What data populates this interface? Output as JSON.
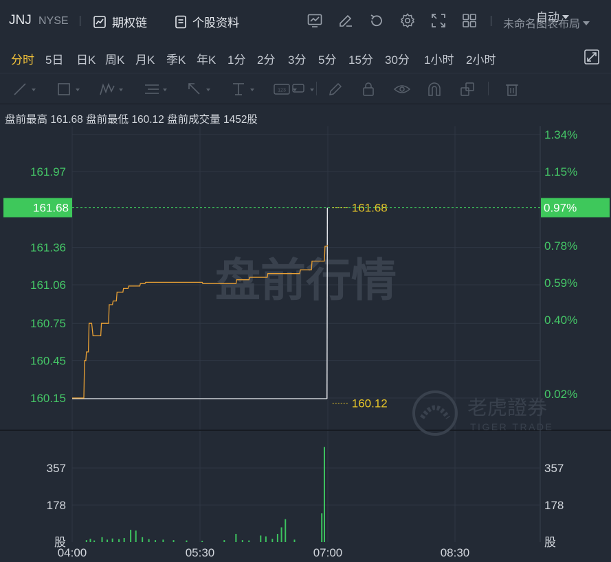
{
  "header": {
    "symbol": "JNJ",
    "exchange": "NYSE",
    "options_chain_label": "期权链",
    "profile_label": "个股资料",
    "layout_name": "未命名图表布局"
  },
  "periods": [
    {
      "label": "分时",
      "active": true
    },
    {
      "label": "5日",
      "active": false
    },
    {
      "label": "日K",
      "active": false
    },
    {
      "label": "周K",
      "active": false
    },
    {
      "label": "月K",
      "active": false
    },
    {
      "label": "季K",
      "active": false
    },
    {
      "label": "年K",
      "active": false
    },
    {
      "label": "1分",
      "active": false
    },
    {
      "label": "2分",
      "active": false
    },
    {
      "label": "3分",
      "active": false
    },
    {
      "label": "5分",
      "active": false
    },
    {
      "label": "15分",
      "active": false
    },
    {
      "label": "30分",
      "active": false
    },
    {
      "label": "1小时",
      "active": false
    },
    {
      "label": "2小时",
      "active": false
    }
  ],
  "auto_label": "自动",
  "drawing_tools": [
    "line-tool-icon",
    "rectangle-tool-icon",
    "pattern-tool-icon",
    "fib-tool-icon",
    "arrow-tool-icon",
    "measure-tool-icon",
    "label-tool-icon",
    "comment-tool-icon",
    "pen-icon",
    "lock-icon",
    "eye-icon",
    "magnet-icon",
    "layers-icon",
    "trash-icon"
  ],
  "info": {
    "high_label": "盘前最高",
    "high_value": "161.68",
    "low_label": "盘前最低",
    "low_value": "160.12",
    "volume_label": "盘前成交量",
    "volume_value": "1452股"
  },
  "watermark": {
    "text": "盘前行情",
    "brand_cn": "老虎證券",
    "brand_en": "TIGER TRADE"
  },
  "colors": {
    "price_line": "#e8a035",
    "axis_green": "#45c767",
    "marker_yellow": "#e6c529",
    "badge_green": "#3ec85b",
    "volume_bar": "#3dc35f",
    "background": "#232a35",
    "grid": "#2f3744"
  },
  "chart_data": {
    "type": "line",
    "x_ticks": [
      "04:00",
      "05:30",
      "07:00",
      "08:30"
    ],
    "price_ticks_left": [
      "161.97",
      "161.68",
      "161.36",
      "161.06",
      "160.75",
      "160.45",
      "160.15"
    ],
    "percent_ticks_right": [
      "1.34%",
      "1.15%",
      "0.97%",
      "0.78%",
      "0.59%",
      "0.40%",
      "0.02%"
    ],
    "current_price_badge": "161.68",
    "current_percent_badge": "0.97%",
    "high_marker": "161.68",
    "low_marker": "160.12",
    "yrange": [
      159.95,
      162.25
    ],
    "xrange_minutes": [
      0,
      360
    ],
    "series": [
      {
        "x": [
          0,
          9,
          9.5,
          10.5,
          11,
          12.5,
          13,
          15,
          16,
          22,
          22.5,
          28,
          28.5,
          31,
          31.5,
          34,
          34.5,
          39,
          39.5,
          43,
          43.5,
          52,
          52.5,
          56,
          56.5,
          100,
          100.5,
          126,
          126.5,
          136,
          136.5,
          150,
          150.5,
          175,
          175.5,
          184,
          184.5,
          194,
          194.5,
          196,
          196.5
        ],
        "y": [
          160.15,
          160.15,
          160.45,
          160.45,
          160.52,
          160.52,
          160.75,
          160.75,
          160.65,
          160.65,
          160.75,
          160.75,
          160.9,
          160.9,
          160.93,
          160.93,
          161.0,
          161.0,
          161.03,
          161.03,
          161.05,
          161.05,
          161.07,
          161.07,
          161.08,
          161.08,
          161.07,
          161.07,
          161.1,
          161.1,
          161.12,
          161.12,
          161.15,
          161.15,
          161.18,
          161.18,
          161.25,
          161.25,
          161.37,
          161.37,
          161.38
        ]
      }
    ],
    "volume": {
      "ticks": [
        "357",
        "178"
      ],
      "unit_label": "股",
      "max": 600,
      "bars": [
        {
          "x": 11,
          "v": 12
        },
        {
          "x": 14,
          "v": 20
        },
        {
          "x": 17,
          "v": 10
        },
        {
          "x": 23,
          "v": 30
        },
        {
          "x": 27,
          "v": 15
        },
        {
          "x": 31,
          "v": 22
        },
        {
          "x": 36,
          "v": 18
        },
        {
          "x": 40,
          "v": 25
        },
        {
          "x": 45,
          "v": 75
        },
        {
          "x": 49,
          "v": 70
        },
        {
          "x": 54,
          "v": 30
        },
        {
          "x": 59,
          "v": 18
        },
        {
          "x": 64,
          "v": 12
        },
        {
          "x": 70,
          "v": 15
        },
        {
          "x": 78,
          "v": 12
        },
        {
          "x": 88,
          "v": 10
        },
        {
          "x": 100,
          "v": 8
        },
        {
          "x": 117,
          "v": 12
        },
        {
          "x": 126,
          "v": 50
        },
        {
          "x": 131,
          "v": 12
        },
        {
          "x": 136,
          "v": 10
        },
        {
          "x": 145,
          "v": 40
        },
        {
          "x": 149,
          "v": 35
        },
        {
          "x": 154,
          "v": 20
        },
        {
          "x": 158,
          "v": 50
        },
        {
          "x": 161,
          "v": 90
        },
        {
          "x": 164,
          "v": 140
        },
        {
          "x": 171,
          "v": 15
        },
        {
          "x": 192,
          "v": 175
        },
        {
          "x": 194,
          "v": 580
        }
      ]
    }
  }
}
